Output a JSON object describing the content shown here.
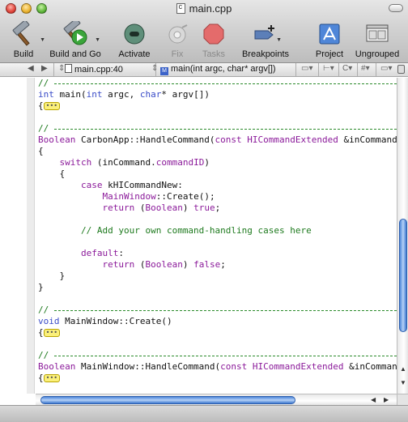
{
  "window": {
    "title": "main.cpp"
  },
  "toolbar": {
    "items": [
      {
        "label": "Build",
        "icon": "hammer-icon"
      },
      {
        "label": "Build and Go",
        "icon": "build-and-go-icon"
      },
      {
        "label": "Activate",
        "icon": "activate-icon"
      },
      {
        "label": "Fix",
        "icon": "fix-icon",
        "disabled": true
      },
      {
        "label": "Tasks",
        "icon": "stop-sign-icon",
        "disabled": true
      },
      {
        "label": "Breakpoints",
        "icon": "breakpoints-icon"
      },
      {
        "label": "Project",
        "icon": "project-icon"
      },
      {
        "label": "Ungrouped",
        "icon": "ungrouped-icon"
      }
    ]
  },
  "navbar": {
    "file": "main.cpp:40",
    "function": "main(int argc, char* argv[])",
    "function_badge": "M",
    "hash": "#"
  },
  "code": {
    "lines": [
      {
        "kind": "rule",
        "text": "//"
      },
      {
        "kind": "code",
        "html_parts": [
          [
            "kw2",
            "int"
          ],
          [
            "",
            " main("
          ],
          [
            "kw2",
            "int"
          ],
          [
            "",
            " argc, "
          ],
          [
            "kw2",
            "char"
          ],
          [
            "",
            "* argv[])"
          ]
        ]
      },
      {
        "kind": "fold",
        "prefix": "{"
      },
      {
        "kind": "blank"
      },
      {
        "kind": "rule",
        "text": "//"
      },
      {
        "kind": "code",
        "html_parts": [
          [
            "kw",
            "Boolean"
          ],
          [
            "",
            " CarbonApp::HandleCommand("
          ],
          [
            "kw",
            "const"
          ],
          [
            "",
            " "
          ],
          [
            "kw",
            "HICommandExtended"
          ],
          [
            "",
            " &inCommand)"
          ]
        ]
      },
      {
        "kind": "code",
        "html_parts": [
          [
            "",
            "{"
          ]
        ]
      },
      {
        "kind": "code",
        "html_parts": [
          [
            "",
            "    "
          ],
          [
            "kw",
            "switch"
          ],
          [
            "",
            " (inCommand."
          ],
          [
            "kw",
            "commandID"
          ],
          [
            "",
            ")"
          ]
        ]
      },
      {
        "kind": "code",
        "html_parts": [
          [
            "",
            "    {"
          ]
        ]
      },
      {
        "kind": "code",
        "html_parts": [
          [
            "",
            "        "
          ],
          [
            "kw",
            "case"
          ],
          [
            "",
            " kHICommandNew:"
          ]
        ]
      },
      {
        "kind": "code",
        "html_parts": [
          [
            "",
            "            "
          ],
          [
            "kw",
            "MainWindow"
          ],
          [
            "",
            "::Create();"
          ]
        ]
      },
      {
        "kind": "code",
        "html_parts": [
          [
            "",
            "            "
          ],
          [
            "kw",
            "return"
          ],
          [
            "",
            " ("
          ],
          [
            "kw",
            "Boolean"
          ],
          [
            "",
            ") "
          ],
          [
            "kw",
            "true"
          ],
          [
            "",
            ";"
          ]
        ]
      },
      {
        "kind": "blank"
      },
      {
        "kind": "code",
        "html_parts": [
          [
            "",
            "        "
          ],
          [
            "cmt",
            "// Add your own command-handling cases here"
          ]
        ]
      },
      {
        "kind": "blank"
      },
      {
        "kind": "code",
        "html_parts": [
          [
            "",
            "        "
          ],
          [
            "kw",
            "default"
          ],
          [
            "",
            ":"
          ]
        ]
      },
      {
        "kind": "code",
        "html_parts": [
          [
            "",
            "            "
          ],
          [
            "kw",
            "return"
          ],
          [
            "",
            " ("
          ],
          [
            "kw",
            "Boolean"
          ],
          [
            "",
            ") "
          ],
          [
            "kw",
            "false"
          ],
          [
            "",
            ";"
          ]
        ]
      },
      {
        "kind": "code",
        "html_parts": [
          [
            "",
            "    }"
          ]
        ]
      },
      {
        "kind": "code",
        "html_parts": [
          [
            "",
            "}"
          ]
        ]
      },
      {
        "kind": "blank"
      },
      {
        "kind": "rule",
        "text": "//"
      },
      {
        "kind": "code",
        "html_parts": [
          [
            "kw2",
            "void"
          ],
          [
            "",
            " MainWindow::Create()"
          ]
        ]
      },
      {
        "kind": "fold",
        "prefix": "{"
      },
      {
        "kind": "blank"
      },
      {
        "kind": "rule",
        "text": "//"
      },
      {
        "kind": "code",
        "html_parts": [
          [
            "kw",
            "Boolean"
          ],
          [
            "",
            " MainWindow::HandleCommand("
          ],
          [
            "kw",
            "const"
          ],
          [
            "",
            " "
          ],
          [
            "kw",
            "HICommandExtended"
          ],
          [
            "",
            " &inCommand)"
          ]
        ]
      },
      {
        "kind": "fold",
        "prefix": "{"
      }
    ]
  },
  "scroll": {
    "vertical_position": 0.82,
    "horizontal_position": 0.0
  }
}
